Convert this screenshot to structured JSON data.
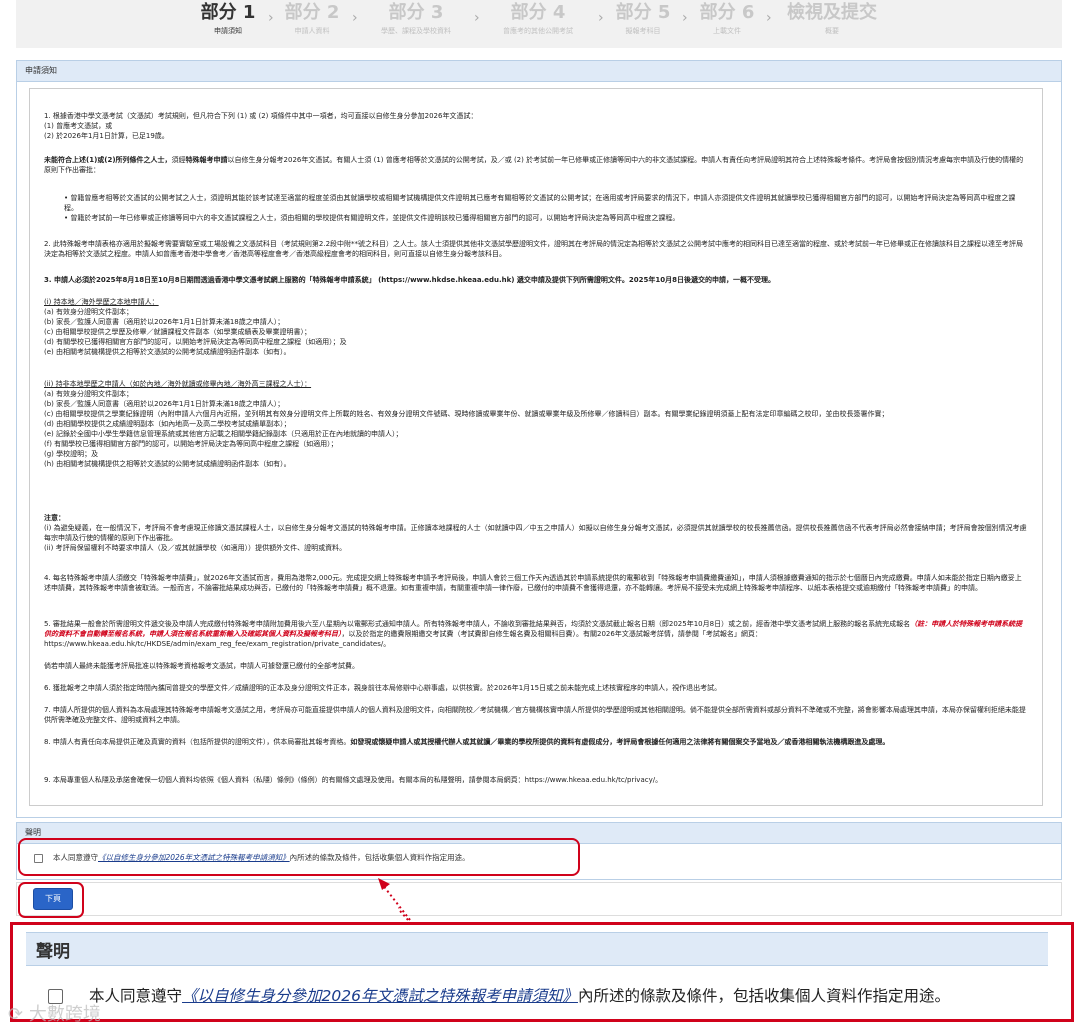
{
  "steps": [
    {
      "title": "部分 1",
      "subtitle": "申請須知",
      "active": true
    },
    {
      "title": "部分 2",
      "subtitle": "申請人資料",
      "active": false
    },
    {
      "title": "部分 3",
      "subtitle": "學歷、課程及學校資料",
      "active": false
    },
    {
      "title": "部分 4",
      "subtitle": "曾應考的其他公開考試",
      "active": false
    },
    {
      "title": "部分 5",
      "subtitle": "擬報考科目",
      "active": false
    },
    {
      "title": "部分 6",
      "subtitle": "上載文件",
      "active": false
    },
    {
      "title": "檢視及提交",
      "subtitle": "概要",
      "active": false
    }
  ],
  "notice_header": "申請須知",
  "notice": {
    "p1": "1. 根據香港中學文憑考試（文憑試）考試規則，但凡符合下列 (1) 或 (2) 項條件中其中一項者，均可直接以自修生身分參加2026年文憑試：",
    "p1a": "(1) 曾應考文憑試，或",
    "p1b": "(2) 於2026年1月1日計算，已足19歲。",
    "p2_bold": "未能符合上述(1)或(2)所列條件之人士，",
    "p2_mid": "須經",
    "p2_bold2": "特殊報考申請",
    "p2_rest": "以自修生身分報考2026年文憑試。有關人士須 (1) 曾應考相等於文憑試的公開考試，及／或 (2) 於考試前一年已修畢或正修讀等同中六的非文憑試課程。申請人有責任向考評局證明其符合上述特殊報考條件。考評局會按個別情況考慮每宗申請及行使的情權的原則下作出審批：",
    "b1": "• 曾籍曾應考相等於文憑試的公開考試之人士，須證明其能於該考試達至適當的程度並須由其就讀學校或相關考試機構提供文件證明其已應考有關相等於文憑試的公開考試；在適用或考評局要求的情況下，申請人亦須提供文件證明其就讀學校已獲得相關官方部門的認可，以開始考評局決定為等同高中程度之課程。",
    "b2": "• 曾籍於考試前一年已修畢或正修讀等同中六的非文憑試課程之人士，須由相關的學校提供有關證明文件，並提供文件證明該校已獲得相關官方部門的認可，以開始考評局決定為等同高中程度之課程。",
    "p3": "2. 此特殊報考申請表格亦適用於擬報考需要實驗室或工場設備之文憑試科目（考試規則第2.2段中附**號之科目）之人士。該人士須提供其他非文憑試學歷證明文件，證明其在考評局的情況定為相等於文憑試之公開考試中應考的相同科目已達至適當的程度、或於考試前一年已修畢或正在修讀該科目之課程以達至考評局決定為相等於文憑試之程度。申請人如曾應考香港中學會考／香港高等程度會考／香港高級程度會考的相同科目，則可直接以自修生身分報考該科目。",
    "p4": "3. 申請人必須於2025年8月18日至10月8日期間透過香港中學文憑考試網上服務的「特殊報考申請系統」 (https://www.hkdse.hkeaa.edu.hk) 遞交申請及提供下列所需證明文件。2025年10月8日後遞交的申請，一概不受理。",
    "g1_title": "(i)    持本地／海外學歷之本地申請人：",
    "g1": [
      "(a)  有效身分證明文件副本；",
      "(b)  家長／監護人同意書（適用於以2026年1月1日計算未滿18歲之申請人）；",
      "(c)  由相關學校提供之學歷及修畢／就讀課程文件副本（如學業成績表及畢業證明書）；",
      "(d)  有關學校已獲得相關官方部門的認可，以開始考評局決定為等同高中程度之課程（如適用）；及",
      "(e)   由相關考試機構提供之相等於文憑試的公開考試成績證明函件副本（如有）。"
    ],
    "g2_title": "(ii) 持非本地學歷之申請人（如於內地／海外就讀或修畢內地／海外高三課程之人士）：",
    "g2": [
      "(a)  有效身分證明文件副本；",
      "(b)  家長／監護人同意書（適用於以2026年1月1日計算未滿18歲之申請人）；",
      "(c)  由相關學校提供之學業紀錄證明（內附申請人六個月內近照，並列明其有效身分證明文件上所載的姓名、有效身分證明文件號碼、現時修讀或畢業年份、就讀或畢業年級及所修畢／修讀科目）副本。有關學業紀錄證明須蓋上配有法定印章編碼之校印，並由校長簽署作實；",
      "(d)  由相關學校提供之成績證明副本（如內地高一及高二學校考試成績單副本）；",
      "(e)  記錄於全國中小學生學籍信息管理系統或其他官方記載之相關學籍紀錄副本（只適用於正在內地就讀的申請人）；",
      "(f)   有關學校已獲得相關官方部門的認可，以開始考評局決定為等同高中程度之課程（如適用）；",
      "(g)  學校證明；及",
      "(h)  由相關考試機構提供之相等於文憑試的公開考試成績證明函件副本（如有）。"
    ],
    "note_title": "注意：",
    "note": [
      "(i)   為避免疑義，在一般情況下，考評局不會考慮現正修讀文憑試課程人士，以自修生身分報考文憑試的特殊報考申請。正修讀本地課程的人士（如就讀中四／中五之申請人）如擬以自修生身分報考文憑試，必須提供其就讀學校的校長推薦信函。提供校長推薦信函不代表考評局必然會接納申請；考評局會按個別情況考慮每宗申請及行使的情權的原則下作出審批。",
      "(ii)   考評局保留權利不時要求申請人（及／或其就讀學校（如適用））提供額外文件、證明或資料。"
    ],
    "p5": "4. 每名特殊報考申請人須繳交「特殊報考申請費」，就2026年文憑試而言，費用為港幣2,000元。完成提交網上特殊報考申請予考評局後，申請人會於三個工作天內透過其於申請系統提供的電郵收到「特殊報考申請費繳費通知」，申請人須根據繳費通知的指示於七個曆日內完成繳費。申請人如未能於指定日期內繳妥上述申請費，其特殊報考申請會被取消。一般而言，不論審批結果成功與否，已繳付的「特殊報考申請費」概不退還。如有重複申請，有關重複申請一律作廢，已繳付的申請費不會獲得退還，亦不能轉讓。考評局不接受未完成網上特殊報考申請程序、以紙本表格提交或逾期繳付「特殊報考申請費」的申請。",
    "p6a": "5. 審批結果一般會於所需證明文件遞交後及申請人完成繳付特殊報考申請附加費用後六至八星期內以電郵形式通知申請人。所有特殊報考申請人，不論收到審批結果與否，均須於文憑試截止報名日期（即2025年10月8日）或之前，經香港中學文憑考試網上服務的報名系統完成報名",
    "p6_red": "（註：申請人於特殊報考申請系統提供的資料不會自動轉至報名系統，申請人須在報名系統重新輸入及確認其個人資料及擬報考科目）",
    "p6b": "，以及於指定的繳費限期繳交考試費（考試費即自修生報名費及相關科目費）。有關2026年文憑試報考詳情，請參閱「考試報名」網頁：https://www.hkeaa.edu.hk/tc/HKDSE/admin/exam_reg_fee/exam_registration/private_candidates/。",
    "p7": "倘若申請人最終未能獲考評局批准以特殊報考資格報考文憑試，申請人可據發還已繳付的全部考試費。",
    "p8": "6. 獲批報考之申請人須於指定時間內攜同曾提交的學歷文件／成績證明的正本及身分證明文件正本，親身前往本局修辦中心辦事處，以供核實。於2026年1月15日或之前未能完成上述核實程序的申請人，視作退出考試。",
    "p9": "7. 申請人所提供的個人資料為本局處理其特殊報考申請報考文憑試之用，考評局亦可能直接提供申請人的個人資料及證明文件，向相關院校／考試機構／官方機構核實申請人所提供的學歷證明或其他相關證明。倘不能提供全部所需資料或部分資料不準確或不完整，將會影響本局處理其申請，本局亦保留權利拒絕未能提供所需準確及完整文件、證明或資料之申請。",
    "p10a": "8. 申請人有責任向本局提供正確及真實的資料（包括所提供的證明文件），供本局審批其報考資格。",
    "p10b": "如發現或懷疑申請人或其授權代辦人或其就讀／畢業的學校所提供的資料有虛假成分，考評局會根據任何適用之法律將有關個案交予當地及／或香港相關執法機構跟進及處理。",
    "p11": "9. 本局專重個人私隱及承諾會確保一切個人資料均依照《個人資料（私隱）條例》(條例）的有關條文處理及使用。有關本局的私隱聲明，請參閱本局網頁：https://www.hkeaa.edu.hk/tc/privacy/。"
  },
  "declaration": {
    "header": "聲明",
    "prefix": "本人同意遵守",
    "link": "《以自修生身分參加2026年文憑試之特殊報考申請須知》",
    "suffix": "內所述的條款及條件，包括收集個人資料作指定用途。",
    "checked": false
  },
  "next_label": "下頁",
  "zoom": {
    "header": "聲明",
    "prefix": "本人同意遵守",
    "link": "《以自修生身分參加2026年文憑試之特殊報考申請須知》",
    "suffix": "內所述的條款及條件，包括收集個人資料作指定用途。"
  },
  "watermark": "大數跨境",
  "colors": {
    "accent": "#2a65c8",
    "highlight": "#d0021b",
    "header_bg": "#dfeaf7"
  }
}
